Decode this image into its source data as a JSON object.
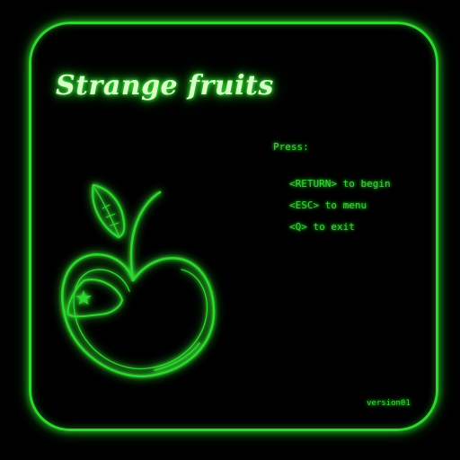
{
  "title": "Strange fruits",
  "instructions": {
    "prompt": "Press:",
    "items": [
      {
        "key": "<RETURN>",
        "action": "to begin"
      },
      {
        "key": "<ESC>",
        "action": "to menu"
      },
      {
        "key": "<Q>",
        "action": "to exit"
      }
    ]
  },
  "version": "version01",
  "icons": {
    "logo": "apple-outline-icon",
    "leaf": "leaf-icon",
    "star": "star-icon"
  },
  "colors": {
    "background": "#000000",
    "neon_green": "#2fd62f",
    "title_glow": "#d8ffc8"
  }
}
